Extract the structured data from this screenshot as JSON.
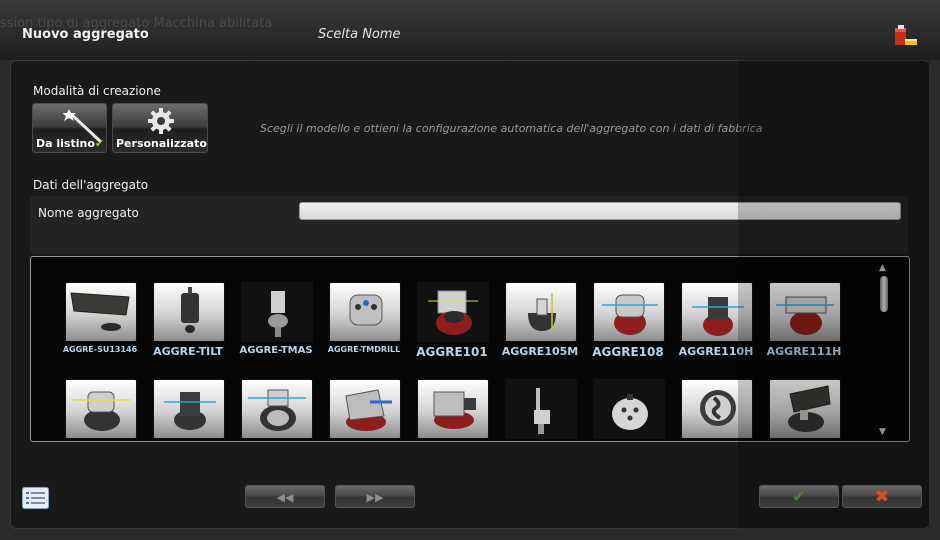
{
  "header": {
    "ghost_text": "ssion  tipo di aggregato   Macchina abilitata",
    "title": "Nuovo aggregato",
    "step": "Scelta Nome",
    "exit_icon": "exit-door-icon"
  },
  "creation_mode": {
    "label": "Modalità di creazione",
    "buttons": [
      {
        "label": "Da listino",
        "icon": "magic-wand-icon",
        "selected": true,
        "check": "✔"
      },
      {
        "label": "Personalizzato",
        "icon": "gear-icon",
        "selected": false
      }
    ],
    "hint": "Scegli il modello e ottieni la configurazione automatica dell'aggregato con i dati di fabbrica"
  },
  "aggregate_data": {
    "label": "Dati dell'aggregato",
    "name_label": "Nome aggregato",
    "name_value": ""
  },
  "catalog": {
    "items": [
      {
        "label": "AGGRE-SU13146"
      },
      {
        "label": "AGGRE-TILT"
      },
      {
        "label": "AGGRE-TMAS"
      },
      {
        "label": "AGGRE-TMDRILL"
      },
      {
        "label": "AGGRE101"
      },
      {
        "label": "AGGRE105M"
      },
      {
        "label": "AGGRE108"
      },
      {
        "label": "AGGRE110H"
      },
      {
        "label": "AGGRE111H"
      },
      {
        "label": ""
      },
      {
        "label": ""
      },
      {
        "label": ""
      },
      {
        "label": ""
      },
      {
        "label": ""
      },
      {
        "label": ""
      },
      {
        "label": ""
      },
      {
        "label": ""
      },
      {
        "label": ""
      }
    ]
  },
  "footer": {
    "list_icon": "list-view-icon",
    "prev_label": "◀◀",
    "next_label": "▶▶",
    "ok_label": "✔",
    "cancel_label": "✖"
  },
  "colors": {
    "accent_label": "#b9d4ea",
    "check_green": "#7fd33a",
    "cancel_red": "#e04a2a"
  }
}
